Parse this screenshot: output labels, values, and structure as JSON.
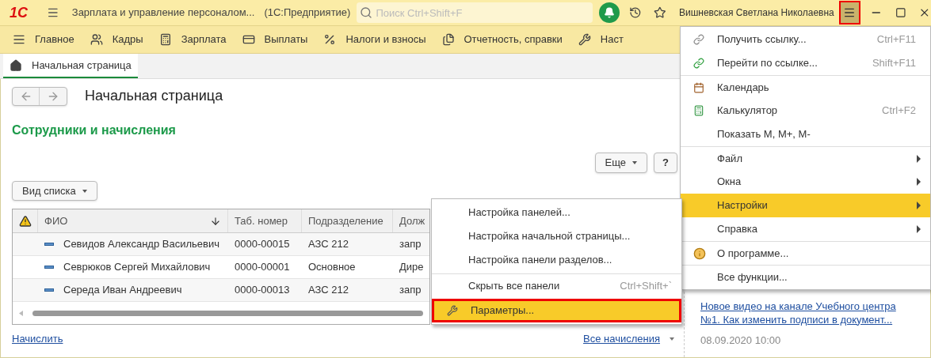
{
  "title_bar": {
    "logo": "1С",
    "app_title": "Зарплата и управление персоналом...",
    "mode": "(1С:Предприятие)",
    "search_placeholder": "Поиск Ctrl+Shift+F",
    "user": "Вишневская Светлана Николаевна",
    "menu_button_outlined": true
  },
  "sections": [
    {
      "label": "Главное",
      "kind": "list"
    },
    {
      "label": "Кадры",
      "kind": "people"
    },
    {
      "label": "Зарплата",
      "kind": "calculator"
    },
    {
      "label": "Выплаты",
      "kind": "card"
    },
    {
      "label": "Налоги и взносы",
      "kind": "percent"
    },
    {
      "label": "Отчетность, справки",
      "kind": "files"
    },
    {
      "label": "Наст",
      "kind": "wrench"
    }
  ],
  "tabs": [
    {
      "label": "Начальная страница",
      "selected": true
    }
  ],
  "page_title": "Начальная страница",
  "section_heading": "Сотрудники и начисления",
  "more_button": "Еще",
  "help_button": "?",
  "view_button": "Вид списка",
  "table": {
    "columns": [
      "ФИО",
      "Таб. номер",
      "Подразделение",
      "Долж"
    ],
    "rows": [
      [
        "Севидов Александр Васильевич",
        "0000-00015",
        "АЗС 212",
        "запр"
      ],
      [
        "Севрюков Сергей Михайлович",
        "0000-00001",
        "Основное",
        "Дире"
      ],
      [
        "Середа Иван Андреевич",
        "0000-00013",
        "АЗС 212",
        "запр"
      ]
    ]
  },
  "accrue_link": "Начислить",
  "all_accruals_link": "Все начисления",
  "news": {
    "link": "Новое видео на канале Учебного центра №1. Как изменить подписи в документ...",
    "date": "08.09.2020 10:00"
  },
  "main_menu": [
    {
      "label": "Получить ссылку...",
      "shortcut": "Ctrl+F11",
      "kind": "link",
      "selected": false,
      "submenu": false,
      "separator_before": false
    },
    {
      "label": "Перейти по ссылке...",
      "shortcut": "Shift+F11",
      "kind": "link-go",
      "selected": false,
      "submenu": false,
      "separator_before": false
    },
    {
      "label": "Календарь",
      "kind": "calendar",
      "selected": false,
      "submenu": false,
      "separator_before": true
    },
    {
      "label": "Калькулятор",
      "shortcut": "Ctrl+F2",
      "kind": "calculator",
      "selected": false,
      "submenu": false,
      "separator_before": false
    },
    {
      "label": "Показать M, M+, M-",
      "selected": false,
      "submenu": false,
      "separator_before": false
    },
    {
      "label": "Файл",
      "selected": false,
      "submenu": true,
      "separator_before": true
    },
    {
      "label": "Окна",
      "selected": false,
      "submenu": true,
      "separator_before": false
    },
    {
      "label": "Настройки",
      "selected": true,
      "submenu": true,
      "separator_before": false
    },
    {
      "label": "Справка",
      "selected": false,
      "submenu": true,
      "separator_before": false
    },
    {
      "label": "О программе...",
      "kind": "info",
      "selected": false,
      "submenu": false,
      "separator_before": true
    },
    {
      "label": "Все функции...",
      "selected": false,
      "submenu": false,
      "separator_before": true
    }
  ],
  "settings_menu": [
    {
      "label": "Настройка панелей...",
      "selected": false,
      "outlined": false,
      "separator_before": false
    },
    {
      "label": "Настройка начальной страницы...",
      "selected": false,
      "outlined": false,
      "separator_before": false
    },
    {
      "label": "Настройка панели разделов...",
      "selected": false,
      "outlined": false,
      "separator_before": false
    },
    {
      "label": "Скрыть все панели",
      "shortcut": "Ctrl+Shift+`",
      "selected": false,
      "outlined": false,
      "separator_before": true
    },
    {
      "label": "Параметры...",
      "kind": "wrench",
      "selected": true,
      "outlined": true,
      "separator_before": true
    }
  ]
}
